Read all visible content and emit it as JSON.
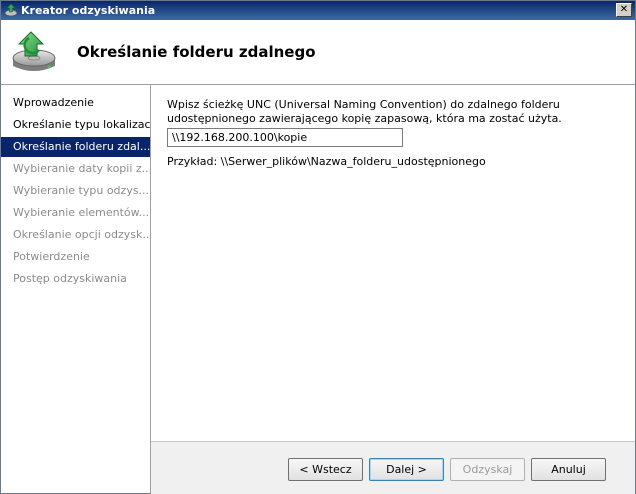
{
  "window": {
    "title": "Kreator odzyskiwania",
    "close_glyph": "✕",
    "icons": {
      "app": "backup-restore-icon",
      "close": "close-icon",
      "header": "disk-restore-icon"
    }
  },
  "header": {
    "title": "Określanie folderu zdalnego"
  },
  "sidebar": {
    "items": [
      {
        "label": "Wprowadzenie",
        "state": "enabled"
      },
      {
        "label": "Określanie typu lokalizacji",
        "state": "enabled"
      },
      {
        "label": "Określanie folderu zdal...",
        "state": "active"
      },
      {
        "label": "Wybieranie daty kopii z...",
        "state": "disabled"
      },
      {
        "label": "Wybieranie typu odzys...",
        "state": "disabled"
      },
      {
        "label": "Wybieranie elementów...",
        "state": "disabled"
      },
      {
        "label": "Określanie opcji odzysk...",
        "state": "disabled"
      },
      {
        "label": "Potwierdzenie",
        "state": "disabled"
      },
      {
        "label": "Postęp odzyskiwania",
        "state": "disabled"
      }
    ]
  },
  "main": {
    "instruction": "Wpisz ścieżkę UNC (Universal Naming Convention) do zdalnego folderu udostępnionego zawierającego kopię zapasową, która ma zostać użyta.",
    "unc_value": "\\\\192.168.200.100\\kopie",
    "example": "Przykład: \\\\Serwer_plików\\Nazwa_folderu_udostępnionego"
  },
  "footer": {
    "back_label": "< Wstecz",
    "next_label": "Dalej >",
    "recover_label": "Odzyskaj",
    "cancel_label": "Anuluj"
  },
  "colors": {
    "titlebar": "#0a246a",
    "selection": "#0a246a",
    "disabled_text": "#8c8c8c"
  }
}
